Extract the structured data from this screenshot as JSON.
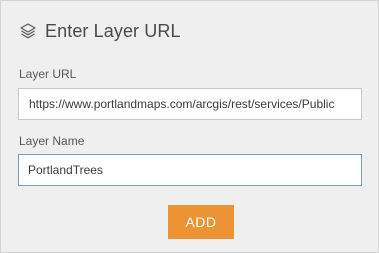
{
  "dialog": {
    "title": "Enter Layer URL",
    "icon": "layers-icon"
  },
  "layer_url": {
    "label": "Layer URL",
    "value": "https://www.portlandmaps.com/arcgis/rest/services/Public"
  },
  "layer_name": {
    "label": "Layer Name",
    "value": "PortlandTrees"
  },
  "add_button": {
    "label": "ADD",
    "color": "#ec9334"
  },
  "colors": {
    "panel_background": "#efefef",
    "focused_border": "#7f9cbb"
  }
}
